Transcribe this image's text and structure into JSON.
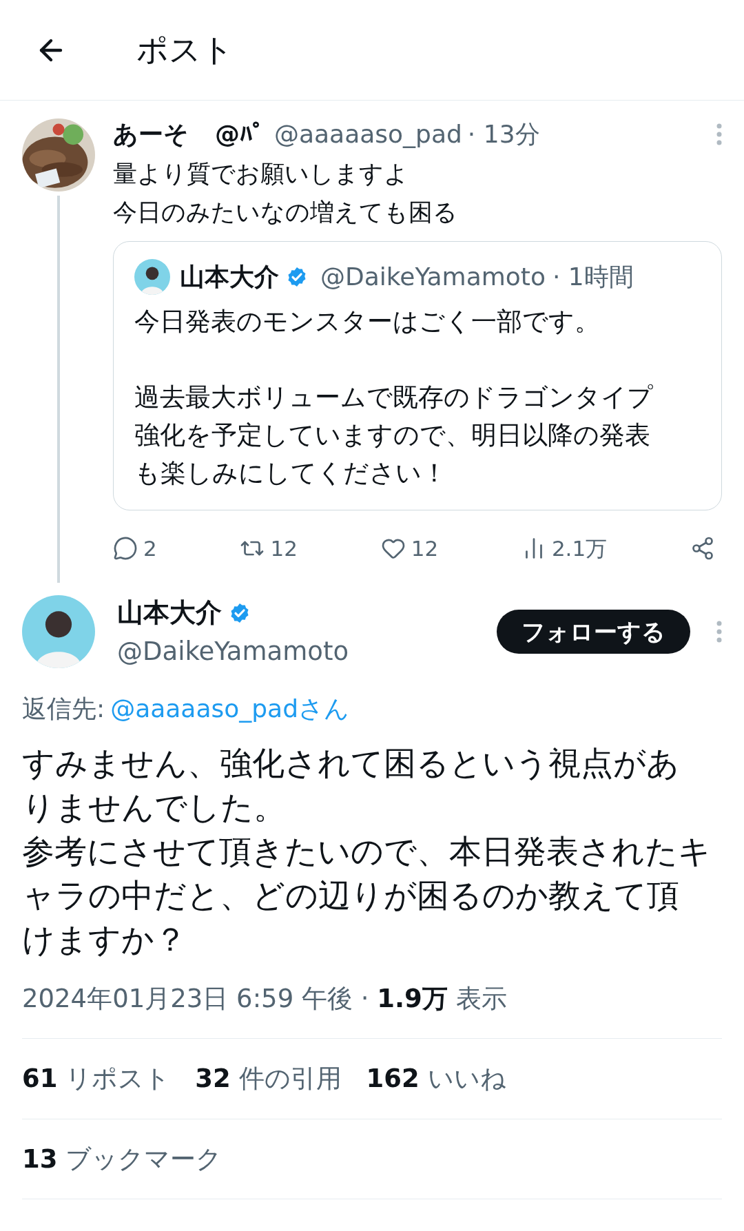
{
  "header": {
    "title": "ポスト"
  },
  "reply_tweet": {
    "display_name": "あーそ",
    "name_suffix": "@ﾊﾟ",
    "handle": "@aaaaaso_pad",
    "time": "· 13分",
    "lines": [
      "量より質でお願いしますよ",
      "今日のみたいなの増えても困る"
    ],
    "quote": {
      "display_name": "山本大介",
      "verified": true,
      "handle": "@DaikeYamamoto",
      "time": "· 1時間",
      "paragraphs": [
        "今日発表のモンスターはごく一部です。",
        "過去最大ボリュームで既存のドラゴンタイプ強化を予定していますので、明日以降の発表も楽しみにしてください！"
      ]
    },
    "actions": [
      {
        "kind": "reply",
        "count": "2"
      },
      {
        "kind": "repost",
        "count": "12"
      },
      {
        "kind": "like",
        "count": "12"
      },
      {
        "kind": "views",
        "count": "2.1万"
      },
      {
        "kind": "share"
      }
    ]
  },
  "main_tweet": {
    "display_name": "山本大介",
    "verified": true,
    "handle": "@DaikeYamamoto",
    "follow_button": "フォローする",
    "reply_to_label": "返信先:",
    "reply_to_link": "@aaaaaso_padさん",
    "lines": [
      "すみません、強化されて困るという視点がありませんでした。",
      "参考にさせて頂きたいので、本日発表されたキャラの中だと、どの辺りが困るのか教えて頂けますか？"
    ],
    "timestamp": "2024年01月23日 6:59 午後 · ",
    "views_count": "1.9万",
    "views_label": " 表示",
    "stats": [
      {
        "count": "61",
        "label": "リポスト"
      },
      {
        "count": "32",
        "label": "件の引用"
      },
      {
        "count": "162",
        "label": "いいね"
      }
    ],
    "bookmarks": {
      "count": "13",
      "label": "ブックマーク"
    }
  }
}
